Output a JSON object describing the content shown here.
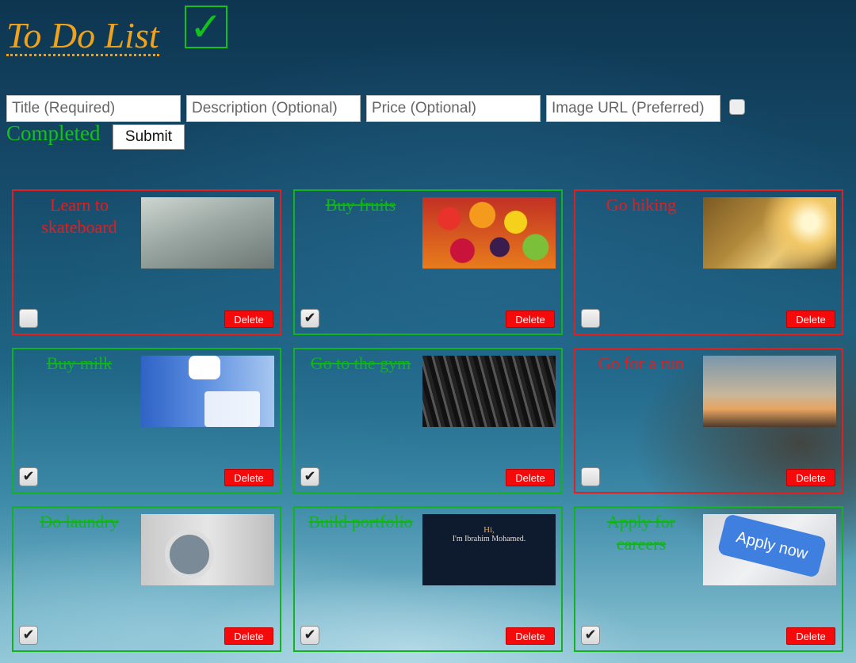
{
  "header": {
    "title": "To Do List"
  },
  "form": {
    "title_placeholder": "Title (Required)",
    "description_placeholder": "Description (Optional)",
    "price_placeholder": "Price (Optional)",
    "image_placeholder": "Image URL (Preferred)",
    "completed_label": "Completed",
    "completed_checked": false,
    "submit_label": "Submit"
  },
  "colors": {
    "title": "#f1a21a",
    "completed": "#13b41b",
    "open": "#e41e1e",
    "delete": "#f40a0a"
  },
  "todos": [
    {
      "title": "Learn to skateboard",
      "completed": false,
      "delete_label": "Delete",
      "image": "skateboard-image"
    },
    {
      "title": "Buy fruits",
      "completed": true,
      "delete_label": "Delete",
      "image": "fruits-image"
    },
    {
      "title": "Go hiking",
      "completed": false,
      "delete_label": "Delete",
      "image": "hiking-image"
    },
    {
      "title": "Buy milk",
      "completed": true,
      "delete_label": "Delete",
      "image": "milk-image"
    },
    {
      "title": "Go to the gym",
      "completed": true,
      "delete_label": "Delete",
      "image": "gym-image"
    },
    {
      "title": "Go for a run",
      "completed": false,
      "delete_label": "Delete",
      "image": "running-image"
    },
    {
      "title": "Do laundry",
      "completed": true,
      "delete_label": "Delete",
      "image": "laundry-image"
    },
    {
      "title": "Build portfolio",
      "completed": true,
      "delete_label": "Delete",
      "image": "portfolio-screenshot-image",
      "image_text": {
        "greeting": "Hi,",
        "name": "I'm Ibrahim Mohamed."
      }
    },
    {
      "title": "Apply for careers",
      "completed": true,
      "delete_label": "Delete",
      "image": "apply-now-image",
      "image_text": {
        "key": "Apply now"
      }
    }
  ]
}
